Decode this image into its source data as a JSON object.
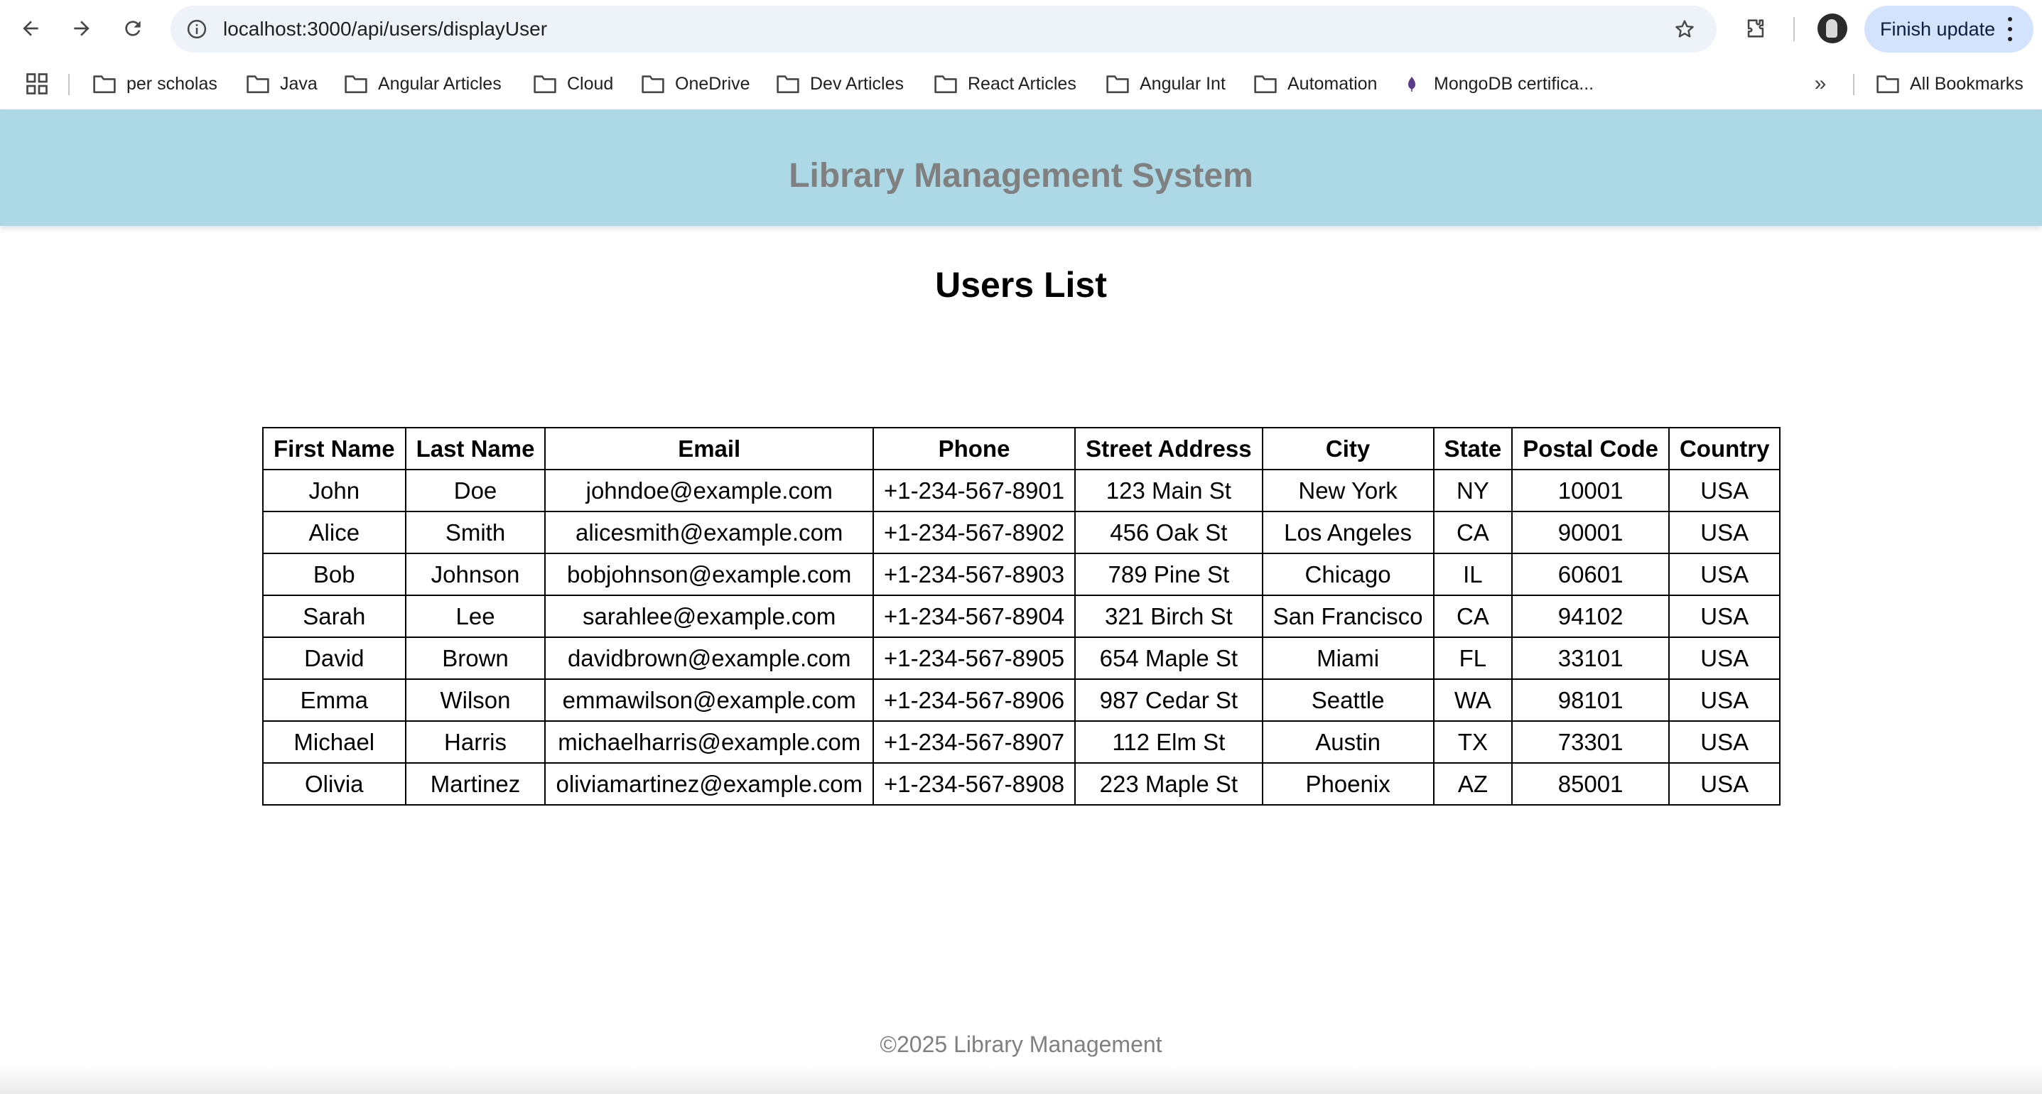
{
  "browser": {
    "url": "localhost:3000/api/users/displayUser",
    "update_label": "Finish update"
  },
  "bookmarks": {
    "items": [
      {
        "label": "per scholas",
        "icon": "folder-icon"
      },
      {
        "label": "Java",
        "icon": "folder-icon"
      },
      {
        "label": "Angular Articles",
        "icon": "folder-icon"
      },
      {
        "label": "Cloud",
        "icon": "folder-icon"
      },
      {
        "label": "OneDrive",
        "icon": "folder-icon"
      },
      {
        "label": "Dev Articles",
        "icon": "folder-icon"
      },
      {
        "label": "React Articles",
        "icon": "folder-icon"
      },
      {
        "label": "Angular Int",
        "icon": "folder-icon"
      },
      {
        "label": "Automation",
        "icon": "folder-icon"
      },
      {
        "label": "MongoDB certifica...",
        "icon": "mongodb-leaf-icon"
      }
    ],
    "more": "»",
    "all_label": "All Bookmarks"
  },
  "page": {
    "header_title": "Library Management System",
    "title": "Users List",
    "footer": "©2025 Library Management",
    "header_color": "#add8e6"
  },
  "table": {
    "headers": [
      "First Name",
      "Last Name",
      "Email",
      "Phone",
      "Street Address",
      "City",
      "State",
      "Postal Code",
      "Country"
    ],
    "rows": [
      [
        "John",
        "Doe",
        "johndoe@example.com",
        "+1-234-567-8901",
        "123 Main St",
        "New York",
        "NY",
        "10001",
        "USA"
      ],
      [
        "Alice",
        "Smith",
        "alicesmith@example.com",
        "+1-234-567-8902",
        "456 Oak St",
        "Los Angeles",
        "CA",
        "90001",
        "USA"
      ],
      [
        "Bob",
        "Johnson",
        "bobjohnson@example.com",
        "+1-234-567-8903",
        "789 Pine St",
        "Chicago",
        "IL",
        "60601",
        "USA"
      ],
      [
        "Sarah",
        "Lee",
        "sarahlee@example.com",
        "+1-234-567-8904",
        "321 Birch St",
        "San Francisco",
        "CA",
        "94102",
        "USA"
      ],
      [
        "David",
        "Brown",
        "davidbrown@example.com",
        "+1-234-567-8905",
        "654 Maple St",
        "Miami",
        "FL",
        "33101",
        "USA"
      ],
      [
        "Emma",
        "Wilson",
        "emmawilson@example.com",
        "+1-234-567-8906",
        "987 Cedar St",
        "Seattle",
        "WA",
        "98101",
        "USA"
      ],
      [
        "Michael",
        "Harris",
        "michaelharris@example.com",
        "+1-234-567-8907",
        "112 Elm St",
        "Austin",
        "TX",
        "73301",
        "USA"
      ],
      [
        "Olivia",
        "Martinez",
        "oliviamartinez@example.com",
        "+1-234-567-8908",
        "223 Maple St",
        "Phoenix",
        "AZ",
        "85001",
        "USA"
      ]
    ]
  }
}
